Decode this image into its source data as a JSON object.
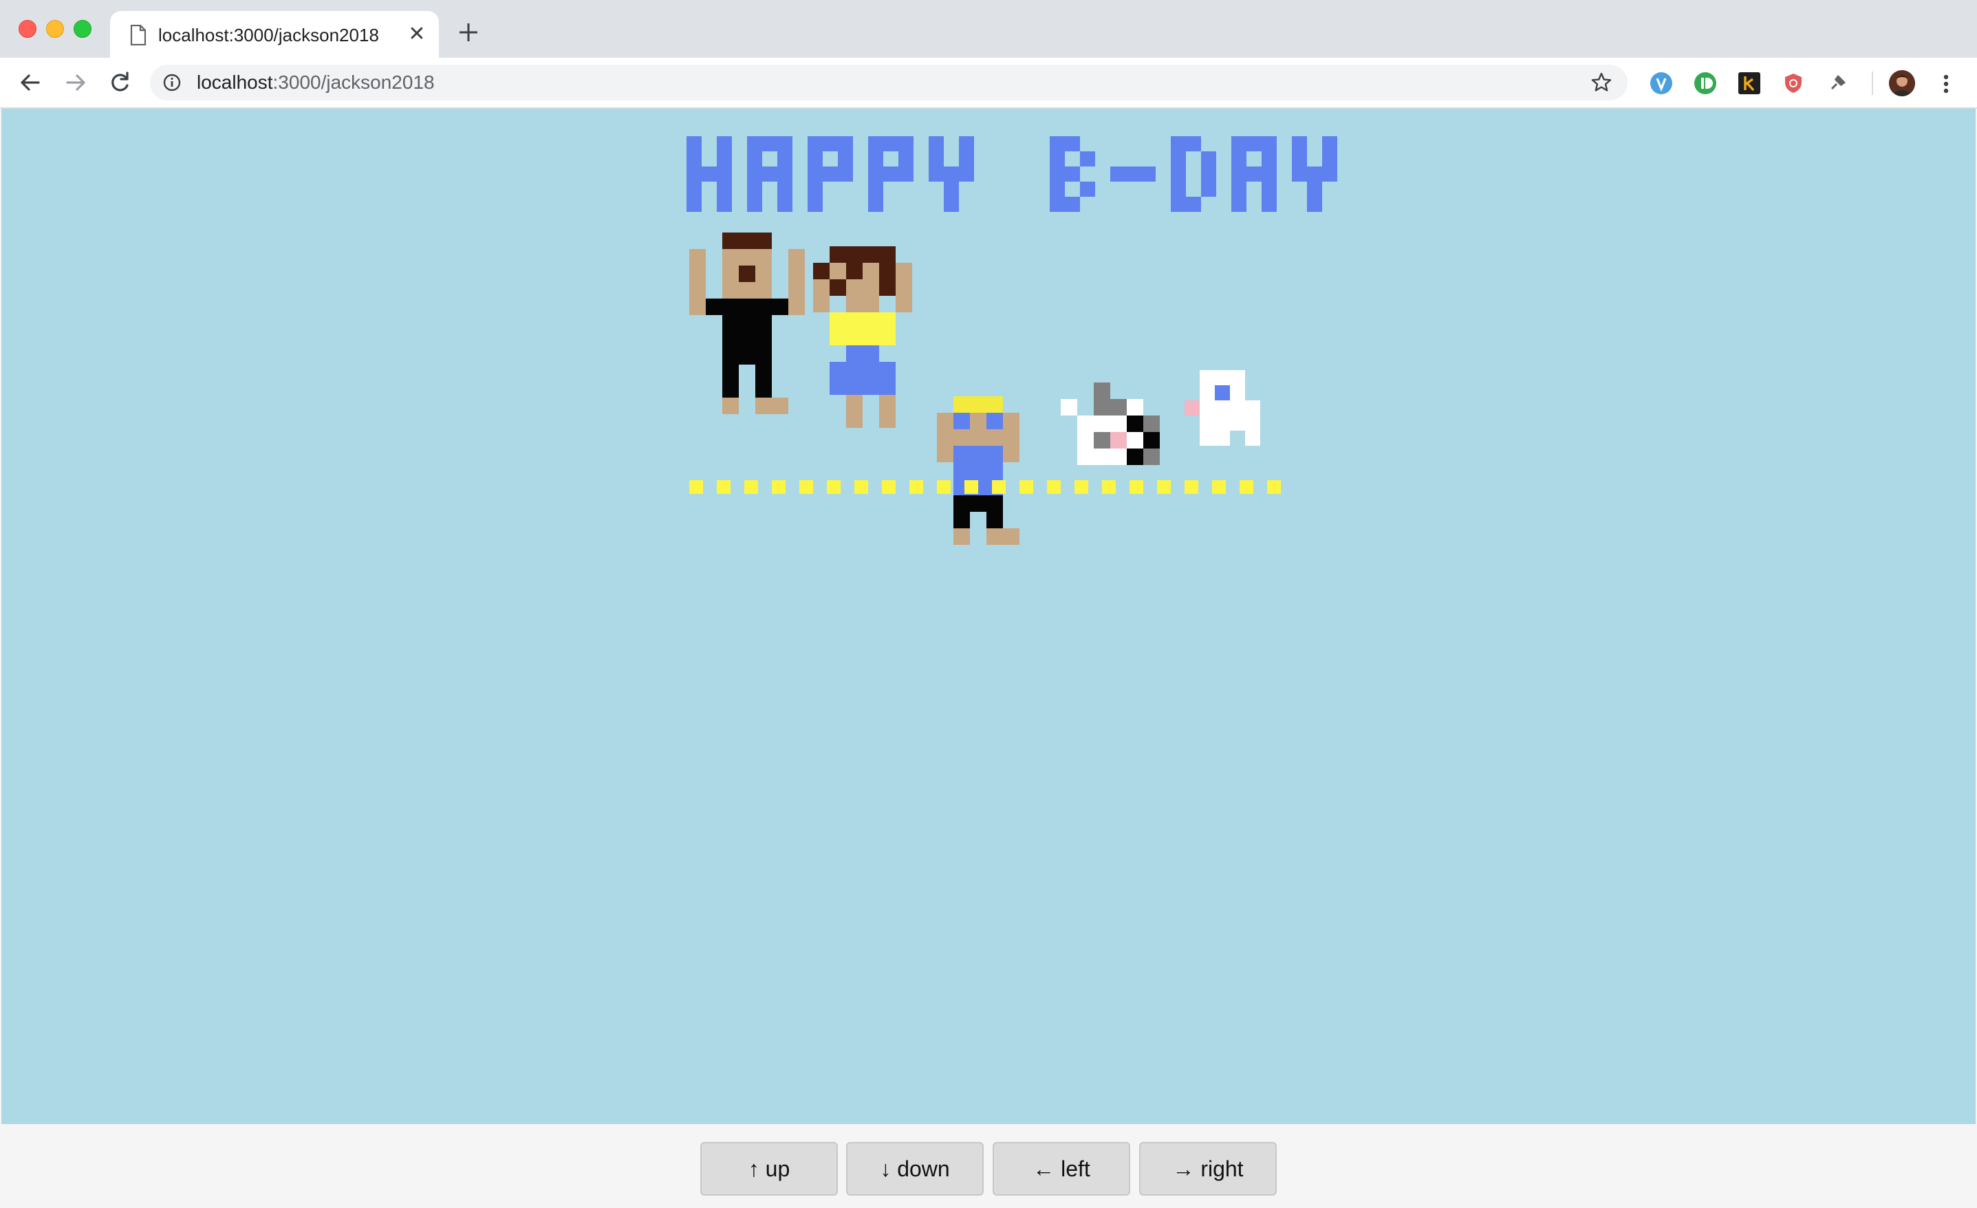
{
  "browser": {
    "tab": {
      "title": "localhost:3000/jackson2018",
      "close_glyph": "✕",
      "icon": "document-icon"
    },
    "new_tab_icon": "plus-icon",
    "url": {
      "host": "localhost",
      "path": ":3000/jackson2018"
    },
    "info_icon": "info-icon",
    "star_icon": "star-icon",
    "extensions": [
      {
        "name": "extension-blue-icon",
        "color": "#4a9fe0"
      },
      {
        "name": "extension-green-icon",
        "color": "#34a853"
      },
      {
        "name": "extension-k-icon",
        "color": "#1f1f1f"
      },
      {
        "name": "extension-shield-icon",
        "color": "#e05a5a"
      },
      {
        "name": "extension-pin-icon",
        "color": "#5f6368"
      }
    ],
    "profile_icon": "profile-avatar",
    "menu_icon": "kebab-menu-icon"
  },
  "page": {
    "background": "#add8e6",
    "banner_text": "HAPPY B-DAY",
    "colors": {
      "letters": "#5f80ef",
      "skin": "#c8a883",
      "hair_dark": "#4a1e0e",
      "shirt_black": "#050505",
      "shirt_yellow": "#fbf84c",
      "blue": "#5f80ef",
      "blonde": "#f2eb3c",
      "white": "#ffffff",
      "gray": "#808080",
      "pink": "#f4b6c2",
      "dots_yellow": "#fcf542"
    },
    "controls": {
      "up": "↑ up",
      "down": "↓ down",
      "left": "← left",
      "right": "→ right"
    }
  }
}
